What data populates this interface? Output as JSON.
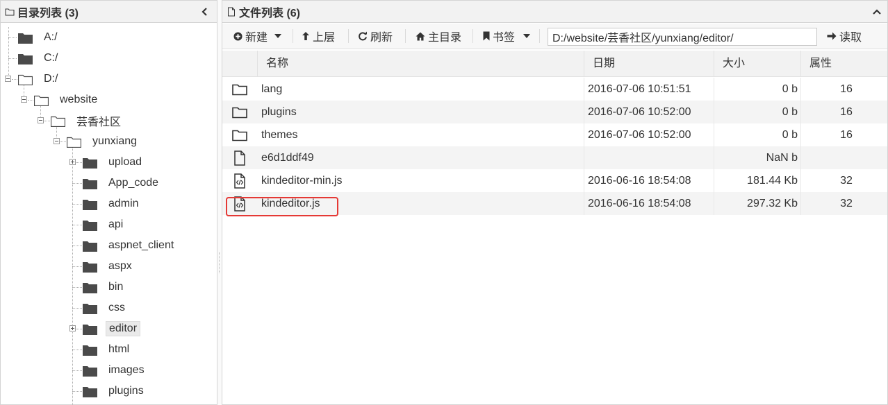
{
  "dir_panel": {
    "title": "目录列表 (3)",
    "nodes": [
      {
        "label": "A:/"
      },
      {
        "label": "C:/"
      },
      {
        "label": "D:/"
      },
      {
        "label": "website"
      },
      {
        "label": "芸香社区"
      },
      {
        "label": "yunxiang"
      },
      {
        "label": "upload"
      },
      {
        "label": "App_code"
      },
      {
        "label": "admin"
      },
      {
        "label": "api"
      },
      {
        "label": "aspnet_client"
      },
      {
        "label": "aspx"
      },
      {
        "label": "bin"
      },
      {
        "label": "css"
      },
      {
        "label": "editor"
      },
      {
        "label": "html"
      },
      {
        "label": "images"
      },
      {
        "label": "plugins"
      }
    ]
  },
  "file_panel": {
    "title": "文件列表 (6)",
    "toolbar": {
      "new_label": "新建",
      "up_label": "上层",
      "refresh_label": "刷新",
      "home_label": "主目录",
      "bookmark_label": "书签",
      "path_value": "D:/website/芸香社区/yunxiang/editor/",
      "read_label": "读取"
    },
    "columns": {
      "name": "名称",
      "date": "日期",
      "size": "大小",
      "attr": "属性"
    },
    "rows": [
      {
        "type": "folder",
        "name": "lang",
        "date": "2016-07-06 10:51:51",
        "size": "0 b",
        "attr": "16"
      },
      {
        "type": "folder",
        "name": "plugins",
        "date": "2016-07-06 10:52:00",
        "size": "0 b",
        "attr": "16"
      },
      {
        "type": "folder",
        "name": "themes",
        "date": "2016-07-06 10:52:00",
        "size": "0 b",
        "attr": "16"
      },
      {
        "type": "file",
        "name": "e6d1ddf49",
        "date": "",
        "size": "NaN b",
        "attr": ""
      },
      {
        "type": "code-file",
        "name": "kindeditor-min.js",
        "date": "2016-06-16 18:54:08",
        "size": "181.44 Kb",
        "attr": "32"
      },
      {
        "type": "code-file",
        "name": "kindeditor.js",
        "date": "2016-06-16 18:54:08",
        "size": "297.32 Kb",
        "attr": "32"
      }
    ]
  },
  "colors": {
    "highlight": "#e53935",
    "header_bg": "#f2f2f2"
  }
}
